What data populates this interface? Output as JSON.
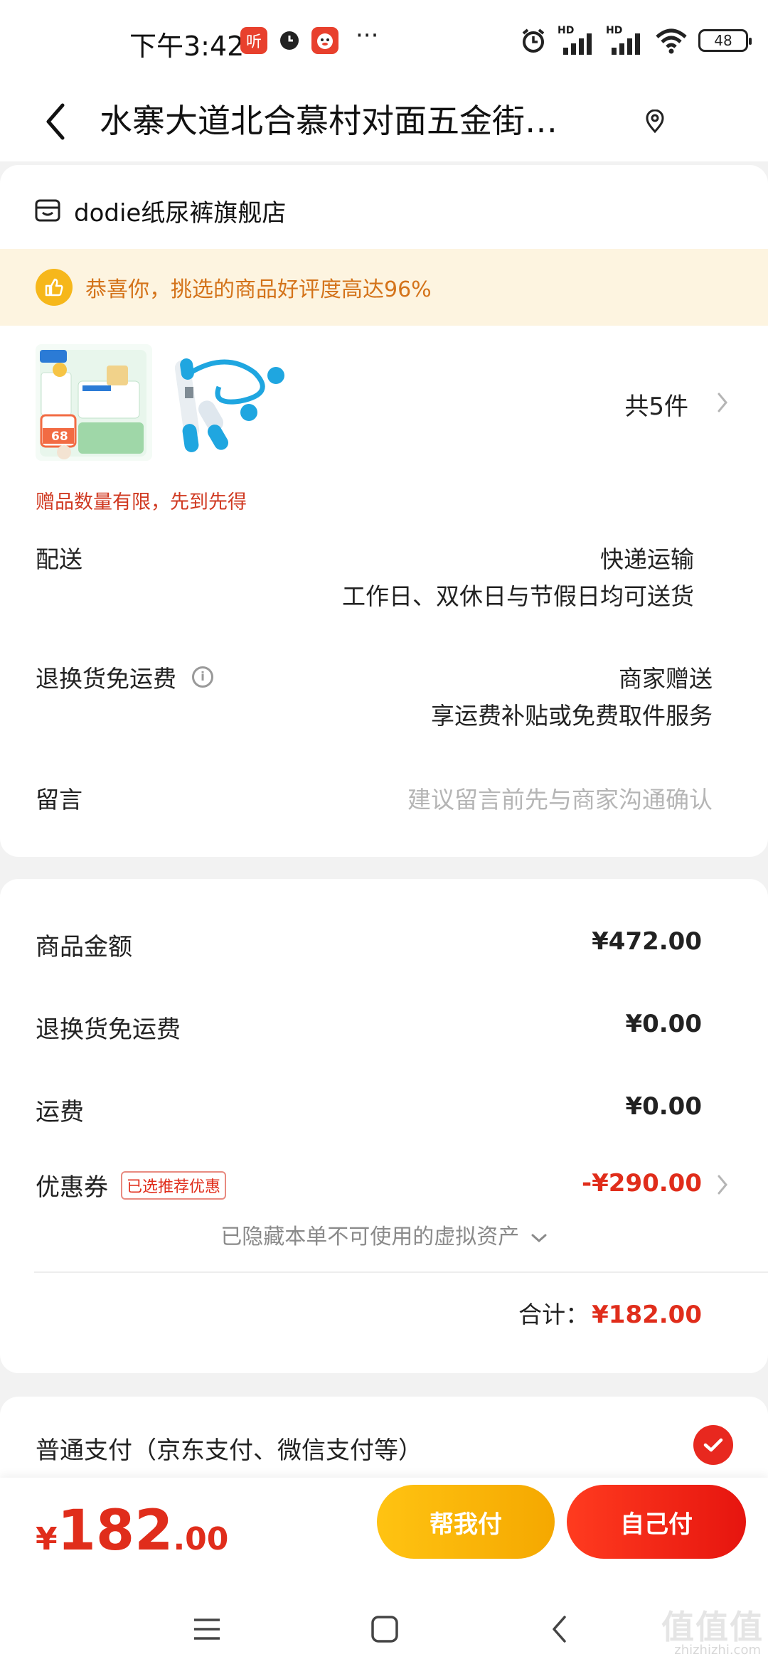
{
  "status_bar": {
    "time": "下午3:42",
    "notif_listen": "听",
    "more": "···",
    "signal_1": "HD",
    "signal_2": "HD",
    "battery": "48"
  },
  "nav": {
    "title": "水寨大道北合慕村对面五金街…"
  },
  "shop": {
    "name": "dodie纸尿裤旗舰店"
  },
  "praise_banner": {
    "text": "恭喜你，挑选的商品好评度高达96%"
  },
  "products": {
    "item1_badge": "68",
    "count": "共5件",
    "gift_note": "赠品数量有限，先到先得"
  },
  "delivery": {
    "label": "配送",
    "method": "快递运输",
    "schedule": "工作日、双休日与节假日均可送货"
  },
  "return_shipping": {
    "label": "退换货免运费",
    "value": "商家赠送",
    "desc": "享运费补贴或免费取件服务"
  },
  "message": {
    "label": "留言",
    "placeholder": "建议留言前先与商家沟通确认"
  },
  "amounts": {
    "goods_label": "商品金额",
    "goods_value": "¥472.00",
    "return_label": "退换货免运费",
    "return_value": "¥0.00",
    "shipping_label": "运费",
    "shipping_value": "¥0.00",
    "coupon_label": "优惠券",
    "coupon_tag": "已选推荐优惠",
    "coupon_value": "-¥290.00",
    "hidden_assets": "已隐藏本单不可使用的虚拟资产",
    "total_label": "合计：",
    "total_value": "¥182.00"
  },
  "payment": {
    "method": "普通支付（京东支付、微信支付等）"
  },
  "bottom": {
    "price_symbol": "¥",
    "price_int": "182",
    "price_dec": ".00",
    "help_pay": "帮我付",
    "self_pay": "自己付"
  },
  "watermark": {
    "main": "值值值",
    "sub": "zhizhizhi.com"
  },
  "colors": {
    "accent_red": "#e02d1b",
    "banner_bg": "#fdf4e0",
    "banner_text": "#d4731a",
    "help_btn": "#ffc312",
    "self_btn": "#ff3b1f"
  }
}
